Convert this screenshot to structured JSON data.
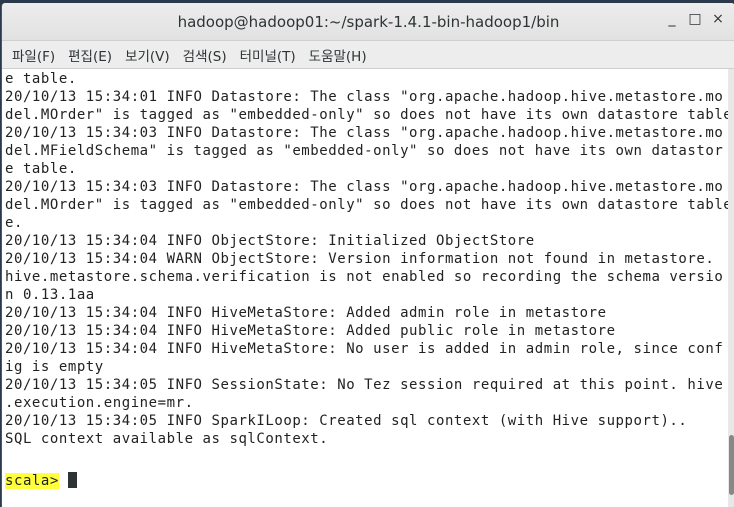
{
  "window": {
    "title": "hadoop@hadoop01:~/spark-1.4.1-bin-hadoop1/bin",
    "minimize": "_",
    "maximize": "□",
    "close": "×"
  },
  "menu": [
    "파일(F)",
    "편집(E)",
    "보기(V)",
    "검색(S)",
    "터미널(T)",
    "도움말(H)"
  ],
  "lines": [
    "e table.",
    "20/10/13 15:34:01 INFO Datastore: The class \"org.apache.hadoop.hive.metastore.mo",
    "del.MOrder\" is tagged as \"embedded-only\" so does not have its own datastore table",
    "20/10/13 15:34:03 INFO Datastore: The class \"org.apache.hadoop.hive.metastore.mo",
    "del.MFieldSchema\" is tagged as \"embedded-only\" so does not have its own datastor",
    "e table.",
    "20/10/13 15:34:03 INFO Datastore: The class \"org.apache.hadoop.hive.metastore.mo",
    "del.MOrder\" is tagged as \"embedded-only\" so does not have its own datastore table",
    "e.",
    "20/10/13 15:34:04 INFO ObjectStore: Initialized ObjectStore",
    "20/10/13 15:34:04 WARN ObjectStore: Version information not found in metastore.",
    "hive.metastore.schema.verification is not enabled so recording the schema versio",
    "n 0.13.1aa",
    "20/10/13 15:34:04 INFO HiveMetaStore: Added admin role in metastore",
    "20/10/13 15:34:04 INFO HiveMetaStore: Added public role in metastore",
    "20/10/13 15:34:04 INFO HiveMetaStore: No user is added in admin role, since conf",
    "ig is empty",
    "20/10/13 15:34:05 INFO SessionState: No Tez session required at this point. hive",
    ".execution.engine=mr.",
    "20/10/13 15:34:05 INFO SparkILoop: Created sql context (with Hive support)..",
    "SQL context available as sqlContext.",
    ""
  ],
  "prompt": "scala>"
}
